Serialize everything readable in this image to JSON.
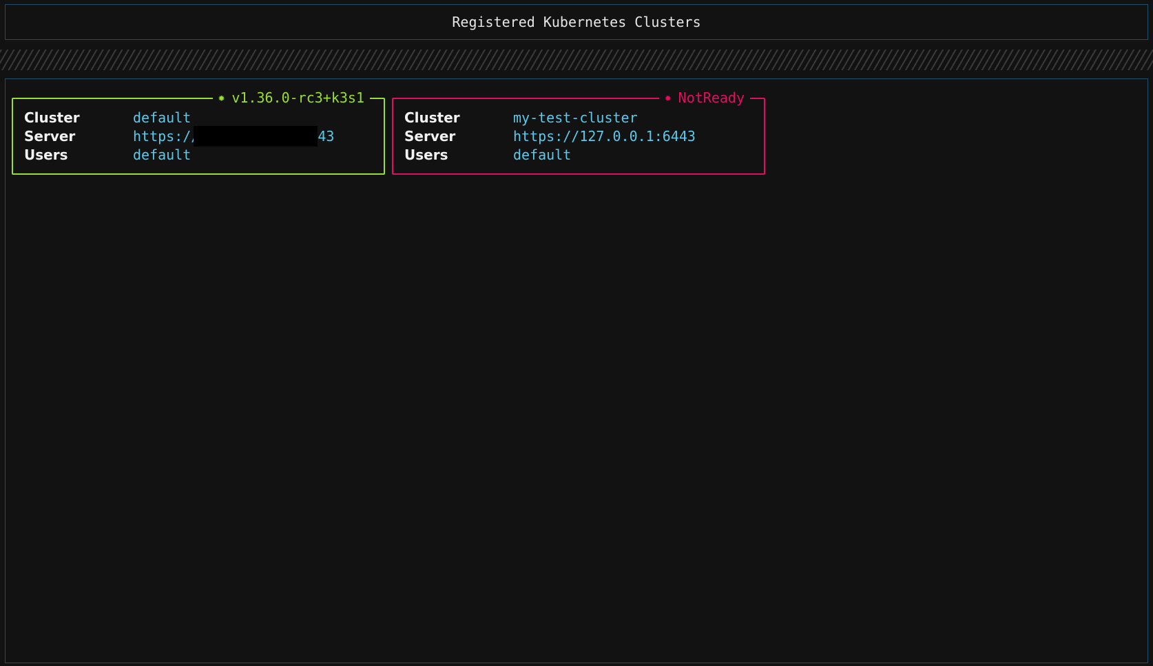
{
  "header": {
    "title": "Registered Kubernetes Clusters"
  },
  "colors": {
    "ready": "#9adf2f",
    "not_ready": "#e0105e",
    "value": "#5ec8ea",
    "border": "#1f4e6b"
  },
  "clusters": [
    {
      "status": "v1.36.0-rc3+k3s1",
      "status_icon": "gear-icon",
      "fields": [
        {
          "label": "Cluster",
          "value": "default"
        },
        {
          "label": "Server",
          "value_prefix": "https://",
          "value_suffix": "43"
        },
        {
          "label": "Users",
          "value": "default"
        }
      ]
    },
    {
      "status": "NotReady",
      "status_icon": "gear-icon",
      "fields": [
        {
          "label": "Cluster",
          "value": "my-test-cluster"
        },
        {
          "label": "Server",
          "value": "https://127.0.0.1:6443"
        },
        {
          "label": "Users",
          "value": "default"
        }
      ]
    }
  ]
}
